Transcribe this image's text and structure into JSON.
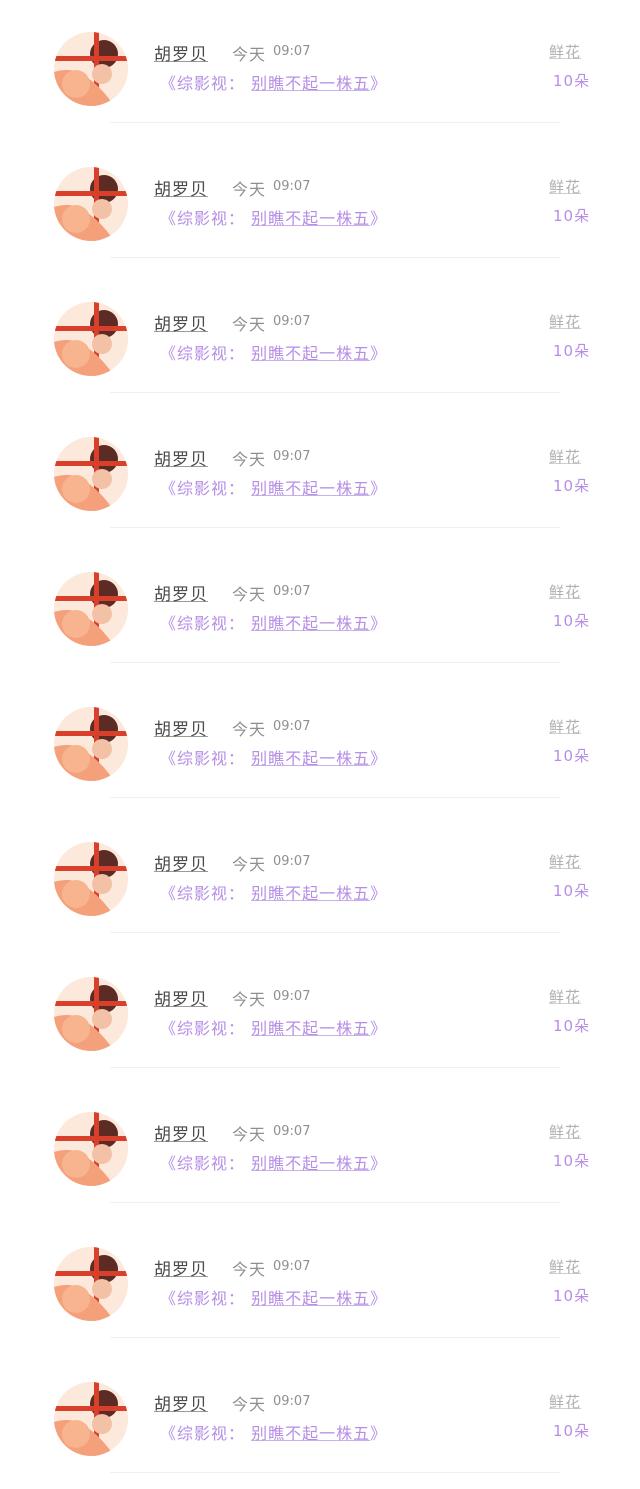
{
  "items": [
    {
      "name": "胡罗贝",
      "day": "今天",
      "time": "09:07",
      "book_open": "《",
      "book_category": "综影视：",
      "book_title": "别瞧不起一株五",
      "book_close": "》",
      "gift_label": "鲜花",
      "gift_count": "10朵"
    },
    {
      "name": "胡罗贝",
      "day": "今天",
      "time": "09:07",
      "book_open": "《",
      "book_category": "综影视：",
      "book_title": "别瞧不起一株五",
      "book_close": "》",
      "gift_label": "鲜花",
      "gift_count": "10朵"
    },
    {
      "name": "胡罗贝",
      "day": "今天",
      "time": "09:07",
      "book_open": "《",
      "book_category": "综影视：",
      "book_title": "别瞧不起一株五",
      "book_close": "》",
      "gift_label": "鲜花",
      "gift_count": "10朵"
    },
    {
      "name": "胡罗贝",
      "day": "今天",
      "time": "09:07",
      "book_open": "《",
      "book_category": "综影视：",
      "book_title": "别瞧不起一株五",
      "book_close": "》",
      "gift_label": "鲜花",
      "gift_count": "10朵"
    },
    {
      "name": "胡罗贝",
      "day": "今天",
      "time": "09:07",
      "book_open": "《",
      "book_category": "综影视：",
      "book_title": "别瞧不起一株五",
      "book_close": "》",
      "gift_label": "鲜花",
      "gift_count": "10朵"
    },
    {
      "name": "胡罗贝",
      "day": "今天",
      "time": "09:07",
      "book_open": "《",
      "book_category": "综影视：",
      "book_title": "别瞧不起一株五",
      "book_close": "》",
      "gift_label": "鲜花",
      "gift_count": "10朵"
    },
    {
      "name": "胡罗贝",
      "day": "今天",
      "time": "09:07",
      "book_open": "《",
      "book_category": "综影视：",
      "book_title": "别瞧不起一株五",
      "book_close": "》",
      "gift_label": "鲜花",
      "gift_count": "10朵"
    },
    {
      "name": "胡罗贝",
      "day": "今天",
      "time": "09:07",
      "book_open": "《",
      "book_category": "综影视：",
      "book_title": "别瞧不起一株五",
      "book_close": "》",
      "gift_label": "鲜花",
      "gift_count": "10朵"
    },
    {
      "name": "胡罗贝",
      "day": "今天",
      "time": "09:07",
      "book_open": "《",
      "book_category": "综影视：",
      "book_title": "别瞧不起一株五",
      "book_close": "》",
      "gift_label": "鲜花",
      "gift_count": "10朵"
    },
    {
      "name": "胡罗贝",
      "day": "今天",
      "time": "09:07",
      "book_open": "《",
      "book_category": "综影视：",
      "book_title": "别瞧不起一株五",
      "book_close": "》",
      "gift_label": "鲜花",
      "gift_count": "10朵"
    },
    {
      "name": "胡罗贝",
      "day": "今天",
      "time": "09:07",
      "book_open": "《",
      "book_category": "综影视：",
      "book_title": "别瞧不起一株五",
      "book_close": "》",
      "gift_label": "鲜花",
      "gift_count": "10朵"
    }
  ],
  "colors": {
    "accent": "#b68ee6",
    "muted": "#8f8f8f",
    "avatar_bg": "#fde9dc",
    "avatar_cross": "#d8402c"
  }
}
